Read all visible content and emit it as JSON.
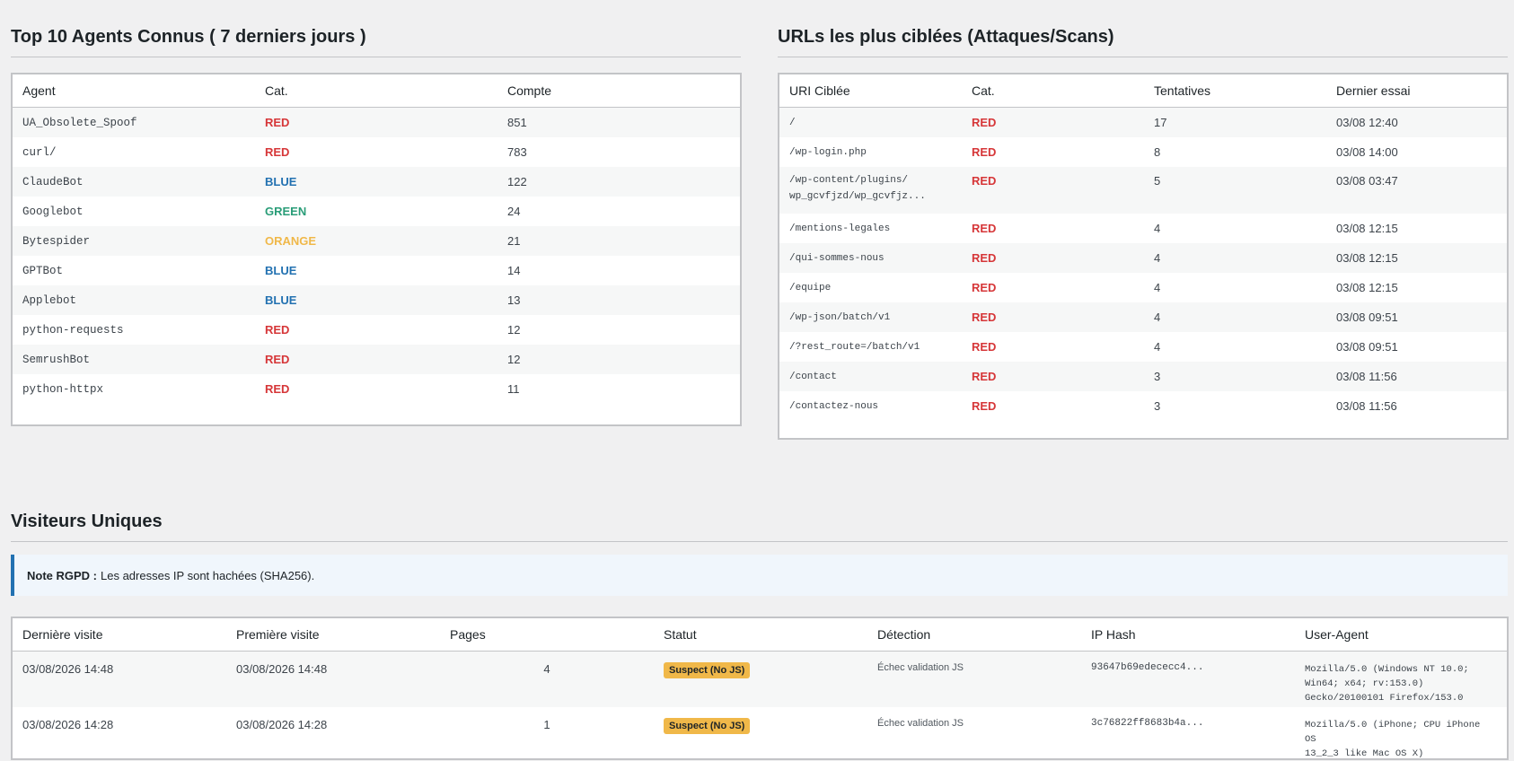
{
  "agents_section": {
    "title": "Top 10 Agents Connus ( 7 derniers jours )",
    "headers": [
      "Agent",
      "Cat.",
      "Compte"
    ],
    "rows": [
      {
        "agent": "UA_Obsolete_Spoof",
        "cat": "RED",
        "count": "851"
      },
      {
        "agent": "curl/",
        "cat": "RED",
        "count": "783"
      },
      {
        "agent": "ClaudeBot",
        "cat": "BLUE",
        "count": "122"
      },
      {
        "agent": "Googlebot",
        "cat": "GREEN",
        "count": "24"
      },
      {
        "agent": "Bytespider",
        "cat": "ORANGE",
        "count": "21"
      },
      {
        "agent": "GPTBot",
        "cat": "BLUE",
        "count": "14"
      },
      {
        "agent": "Applebot",
        "cat": "BLUE",
        "count": "13"
      },
      {
        "agent": "python-requests",
        "cat": "RED",
        "count": "12"
      },
      {
        "agent": "SemrushBot",
        "cat": "RED",
        "count": "12"
      },
      {
        "agent": "python-httpx",
        "cat": "RED",
        "count": "11"
      }
    ]
  },
  "urls_section": {
    "title": "URLs les plus ciblées (Attaques/Scans)",
    "headers": [
      "URI Ciblée",
      "Cat.",
      "Tentatives",
      "Dernier essai"
    ],
    "rows": [
      {
        "uri": "/",
        "cat": "RED",
        "attempts": "17",
        "last": "03/08 12:40"
      },
      {
        "uri": "/wp-login.php",
        "cat": "RED",
        "attempts": "8",
        "last": "03/08 14:00"
      },
      {
        "uri": "/wp-content/plugins/ wp_gcvfjzd/wp_gcvfjz...",
        "uri_line1": "/wp-content/plugins/",
        "uri_line2": "wp_gcvfjzd/wp_gcvfjz...",
        "cat": "RED",
        "attempts": "5",
        "last": "03/08 03:47"
      },
      {
        "uri": "/mentions-legales",
        "cat": "RED",
        "attempts": "4",
        "last": "03/08 12:15"
      },
      {
        "uri": "/qui-sommes-nous",
        "cat": "RED",
        "attempts": "4",
        "last": "03/08 12:15"
      },
      {
        "uri": "/equipe",
        "cat": "RED",
        "attempts": "4",
        "last": "03/08 12:15"
      },
      {
        "uri": "/wp-json/batch/v1",
        "cat": "RED",
        "attempts": "4",
        "last": "03/08 09:51"
      },
      {
        "uri": "/?rest_route=/batch/v1",
        "cat": "RED",
        "attempts": "4",
        "last": "03/08 09:51"
      },
      {
        "uri": "/contact",
        "cat": "RED",
        "attempts": "3",
        "last": "03/08 11:56"
      },
      {
        "uri": "/contactez-nous",
        "cat": "RED",
        "attempts": "3",
        "last": "03/08 11:56"
      }
    ]
  },
  "visitors_section": {
    "title": "Visiteurs Uniques",
    "notice_label": "Note RGPD :",
    "notice_text": "Les adresses IP sont hachées (SHA256).",
    "headers": [
      "Dernière visite",
      "Première visite",
      "Pages",
      "Statut",
      "Détection",
      "IP Hash",
      "User-Agent"
    ],
    "rows": [
      {
        "last_visit": "03/08/2026 14:48",
        "first_visit": "03/08/2026 14:48",
        "pages": "4",
        "status": "Suspect (No JS)",
        "detection": "Échec validation JS",
        "ip_hash": "93647b69edececc4...",
        "ua_lines": [
          "Mozilla/5.0 (Windows NT 10.0;",
          "Win64; x64; rv:153.0)",
          "Gecko/20100101 Firefox/153.0"
        ]
      },
      {
        "last_visit": "03/08/2026 14:28",
        "first_visit": "03/08/2026 14:28",
        "pages": "1",
        "status": "Suspect (No JS)",
        "detection": "Échec validation JS",
        "ip_hash": "3c76822ff8683b4a...",
        "ua_lines": [
          "Mozilla/5.0 (iPhone; CPU iPhone OS",
          "13_2_3 like Mac OS X)"
        ]
      }
    ]
  },
  "colors": {
    "RED": "#d63638",
    "BLUE": "#2271b1",
    "GREEN": "#2a9d78",
    "ORANGE": "#f0b849",
    "badge": "#f0b849",
    "notice_border": "#2271b1"
  }
}
